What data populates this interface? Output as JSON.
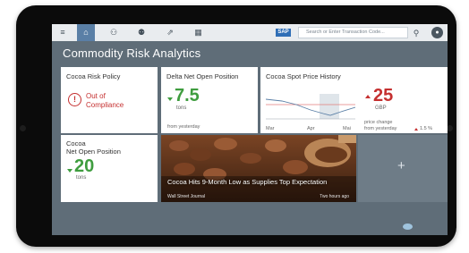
{
  "app": {
    "title": "Commodity Risk Analytics"
  },
  "topbar": {
    "sap_label": "SAP",
    "search_placeholder": "Search or Enter Transaction Code...",
    "icons": [
      "menu-icon",
      "home-icon",
      "org-icon",
      "people-icon",
      "share-icon",
      "grid-icon",
      "search-icon",
      "user-icon"
    ]
  },
  "tiles": {
    "risk_policy": {
      "title": "Cocoa Risk Policy",
      "status_line1": "Out of",
      "status_line2": "Compliance",
      "status_color": "#c53030"
    },
    "delta": {
      "title": "Delta Net Open Position",
      "value": "7.5",
      "unit": "tons",
      "footnote": "from yesterday"
    },
    "spot": {
      "title": "Cocoa Spot Price History",
      "value": "25",
      "unit": "GBP",
      "footnote_line1": "price change",
      "footnote_line2": "from yesterday",
      "pct": "1.5 %",
      "chart_months": [
        "Mar",
        "Apr",
        "Mai"
      ]
    },
    "net_open": {
      "title_line1": "Cocoa",
      "title_line2": "Net Open Position",
      "value": "20",
      "unit": "tons"
    },
    "news": {
      "headline": "Cocoa Hits 9-Month Low as Supplies Top Expectation",
      "source": "Wall Street Journal",
      "time": "Two hours ago"
    },
    "add": {
      "symbol": "+"
    }
  },
  "colors": {
    "accent_green": "#3f9d3f",
    "accent_red": "#c53030",
    "shell": "#5f6d78"
  }
}
